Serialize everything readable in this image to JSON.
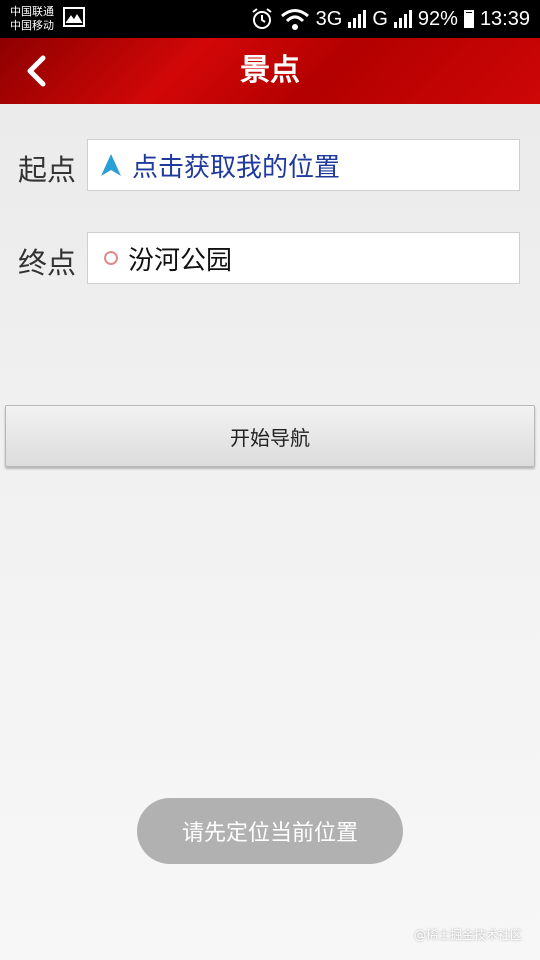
{
  "status_bar": {
    "carrier_1": "中国联通",
    "carrier_2": "中国移动",
    "network_1": "3G",
    "network_2": "G",
    "battery": "92%",
    "time": "13:39",
    "icons": [
      "gallery-icon",
      "alarm-icon",
      "wifi-icon",
      "signal-icon",
      "battery-icon"
    ]
  },
  "header": {
    "title": "景点",
    "back_icon": "chevron-left-icon",
    "colors": {
      "background": "#c40404",
      "text": "#ffffff"
    }
  },
  "form": {
    "start": {
      "label": "起点",
      "value": "点击获取我的位置",
      "icon": "navigation-arrow-icon",
      "color": "#1f3a9c"
    },
    "end": {
      "label": "终点",
      "value": "汾河公园",
      "icon": "circle-marker-icon",
      "color": "#e05a5a"
    }
  },
  "actions": {
    "navigate_label": "开始导航"
  },
  "toast": {
    "message": "请先定位当前位置"
  },
  "watermark": "@稀土掘金技术社区"
}
